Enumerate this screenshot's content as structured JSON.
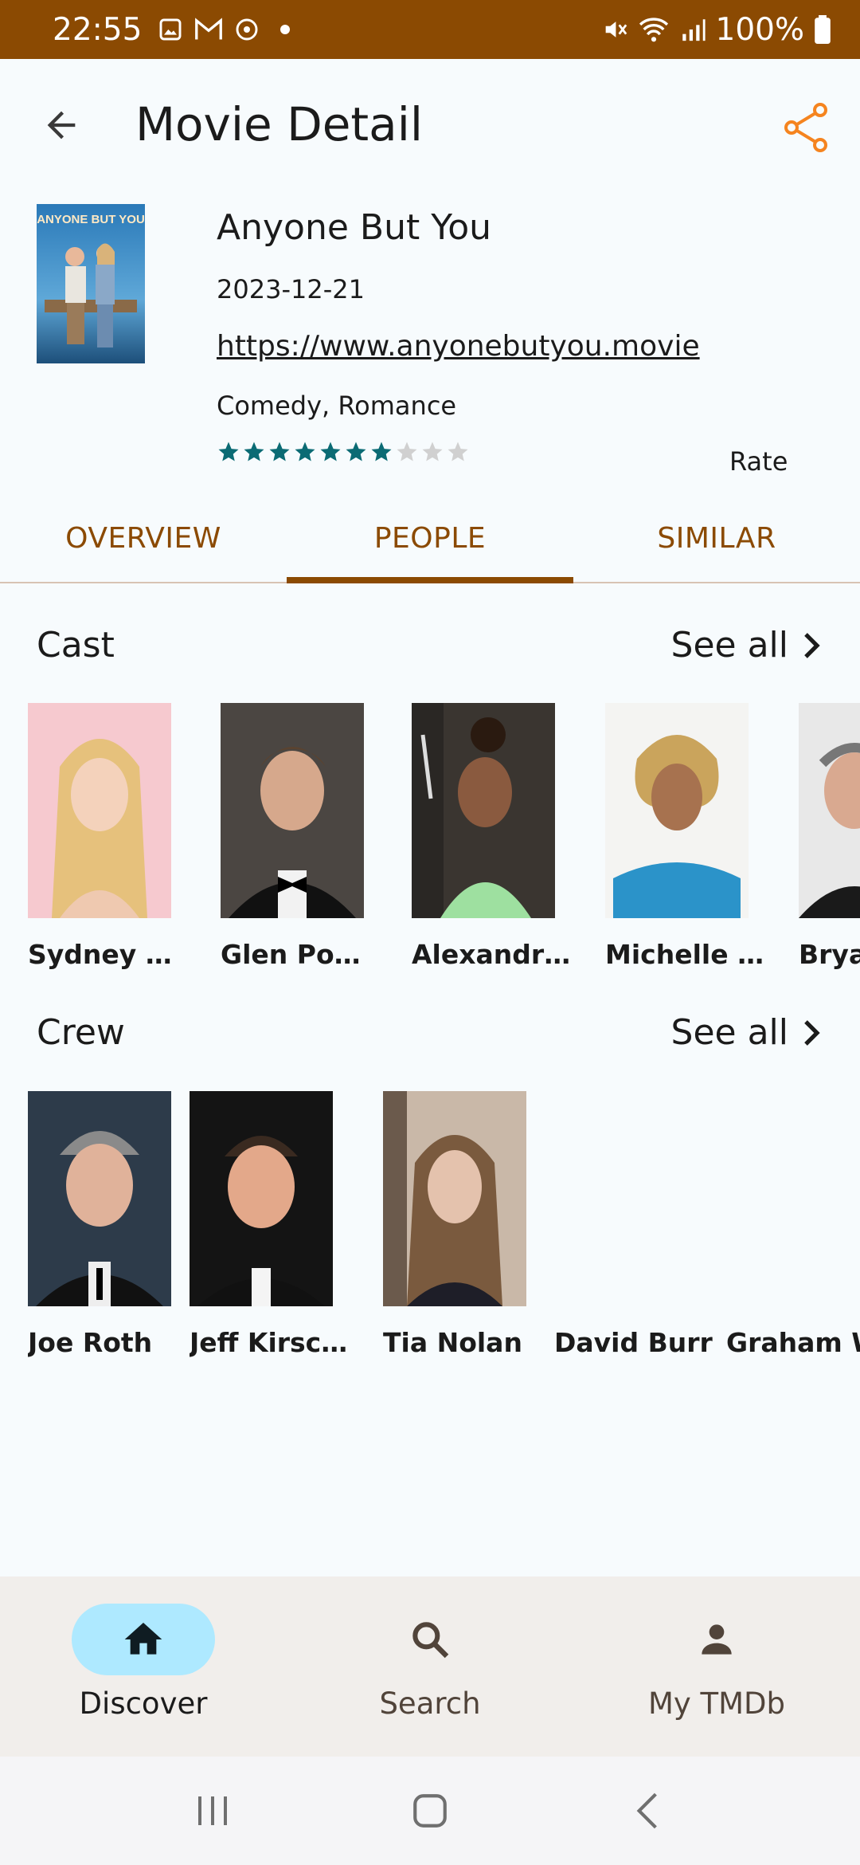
{
  "status_bar": {
    "time": "22:55",
    "battery": "100%"
  },
  "header": {
    "title": "Movie Detail"
  },
  "movie": {
    "title": "Anyone But You",
    "release_date": "2023-12-21",
    "homepage": "https://www.anyonebutyou.movie",
    "genres": "Comedy, Romance",
    "rating_stars_filled": 7,
    "rating_stars_total": 10,
    "rate_label": "Rate",
    "poster_text": "ANYONE BUT YOU"
  },
  "tabs": [
    {
      "label": "OVERVIEW",
      "active": false
    },
    {
      "label": "PEOPLE",
      "active": true
    },
    {
      "label": "SIMILAR",
      "active": false
    }
  ],
  "cast": {
    "title": "Cast",
    "see_all": "See all",
    "people": [
      {
        "name": "Sydney S…"
      },
      {
        "name": "Glen Powell"
      },
      {
        "name": "Alexandra…"
      },
      {
        "name": "Michelle …"
      },
      {
        "name": "Brya"
      }
    ]
  },
  "crew": {
    "title": "Crew",
    "see_all": "See all",
    "people": [
      {
        "name": "Joe Roth"
      },
      {
        "name": "Jeff Kirsc…"
      },
      {
        "name": "Tia Nolan"
      },
      {
        "name": "David Burr"
      },
      {
        "name": "Graham W."
      }
    ]
  },
  "bottom_nav": [
    {
      "label": "Discover",
      "icon": "home-icon",
      "active": true
    },
    {
      "label": "Search",
      "icon": "search-icon",
      "active": false
    },
    {
      "label": "My TMDb",
      "icon": "person-icon",
      "active": false
    }
  ],
  "colors": {
    "brand": "#8b4a02",
    "share_accent": "#f5841f",
    "star_filled": "#0b6b74",
    "star_empty": "#d0d0d0",
    "nav_active": "#aee9ff"
  }
}
